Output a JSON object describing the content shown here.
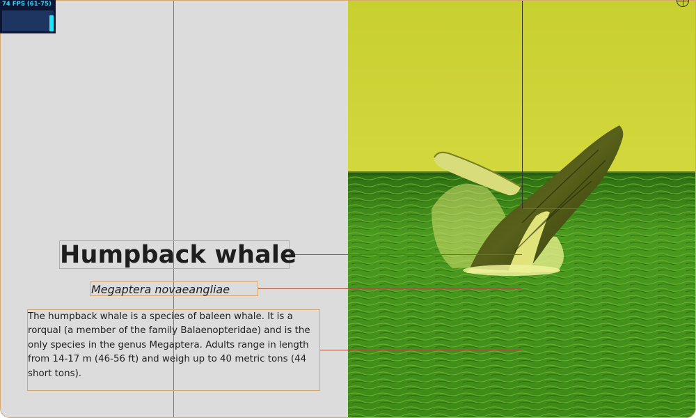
{
  "fps_meter": {
    "label": "74 FPS (61-75)",
    "current_fps": 74,
    "fps_min": 61,
    "fps_max": 75,
    "bar_color": "#22e6f2",
    "text_color": "#3ad1f0",
    "background": "#0b1635"
  },
  "content": {
    "title": "Humpback whale",
    "scientific_name": "Megaptera novaeangliae",
    "description": "The humpback whale is a species of baleen whale. It is a rorqual (a member of the family Balaenopteridae) and is the only species in the genus Megaptera. Adults range in length from 14-17 m (46-56 ft) and weigh up to 40 metric tons (44 short tons)."
  },
  "image": {
    "subject": "humpback whale breaching",
    "tint": "#c9d12e",
    "sea_color": "#4f9a1c"
  },
  "colors": {
    "panel_background": "#dcdcdc",
    "text": "#1e1e1e",
    "debug_outline": "#d7a86e",
    "guide_vertical": "#6b8f5a",
    "guide_horizontal": "#a0523c"
  }
}
